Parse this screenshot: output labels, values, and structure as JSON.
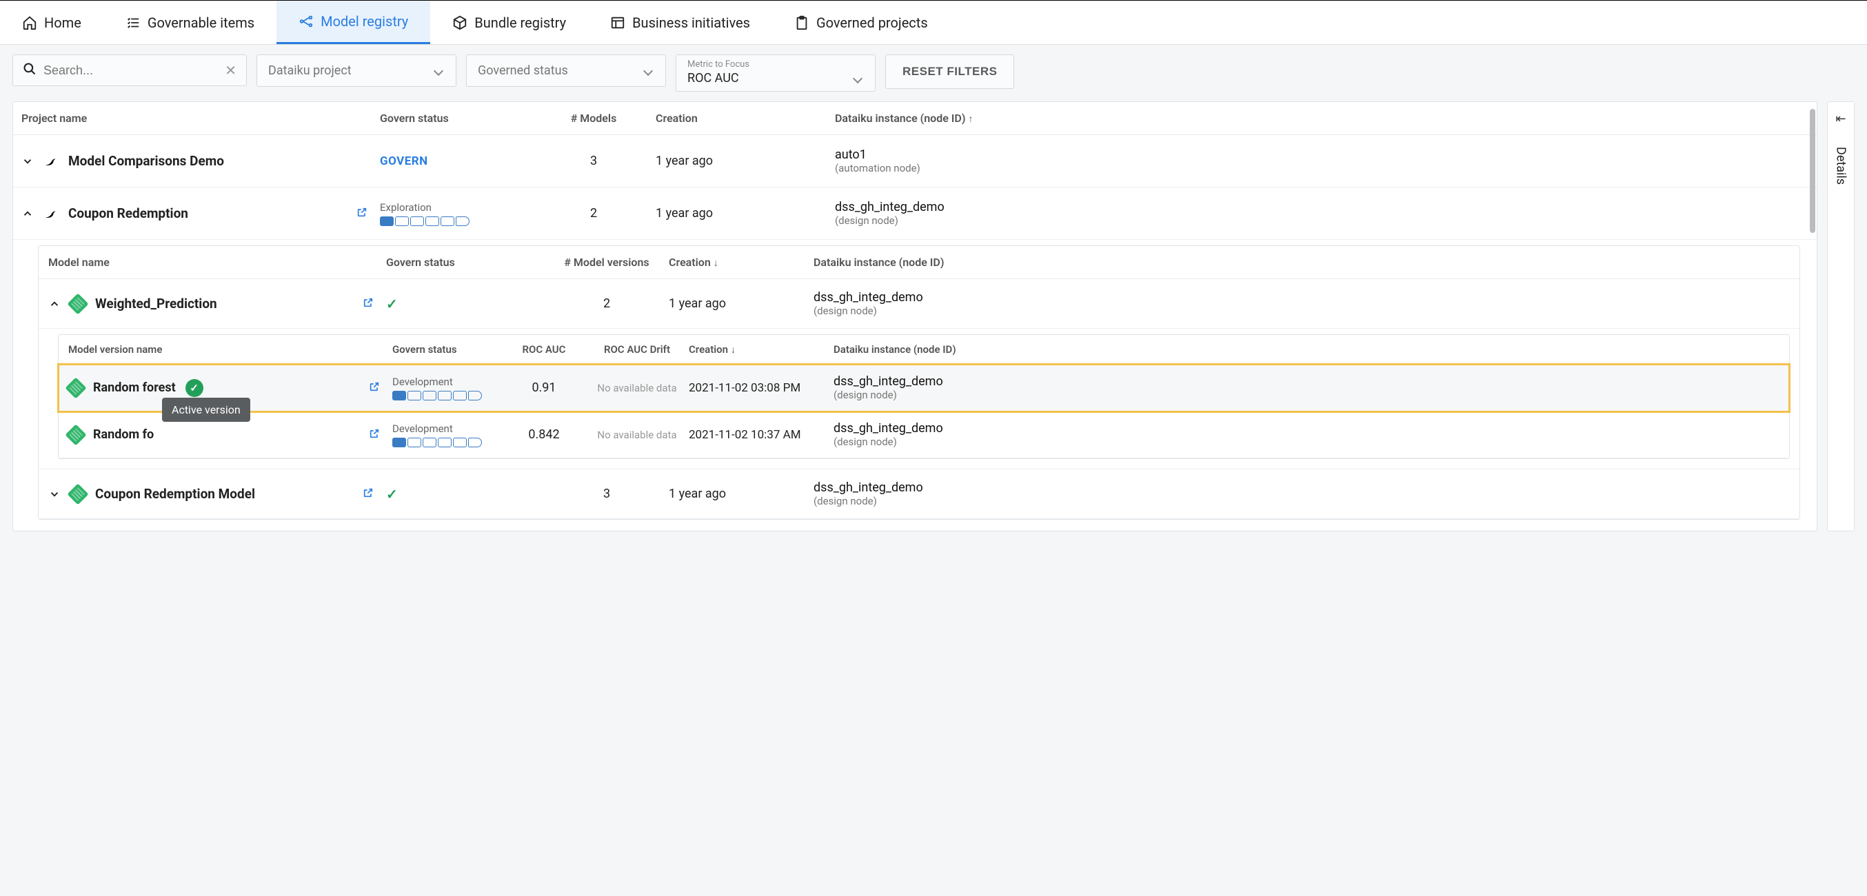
{
  "nav": {
    "home": "Home",
    "governable": "Governable items",
    "model_registry": "Model registry",
    "bundle_registry": "Bundle registry",
    "business": "Business initiatives",
    "governed": "Governed projects"
  },
  "filters": {
    "search_placeholder": "Search...",
    "project_dropdown": "Dataiku project",
    "status_dropdown": "Governed status",
    "metric_label": "Metric to Focus",
    "metric_value": "ROC AUC",
    "reset": "RESET FILTERS"
  },
  "headers": {
    "project": "Project name",
    "govern_status": "Govern status",
    "models": "# Models",
    "creation": "Creation",
    "instance": "Dataiku instance (node ID)"
  },
  "model_headers": {
    "name": "Model name",
    "govern_status": "Govern status",
    "versions": "# Model versions",
    "creation": "Creation",
    "instance": "Dataiku instance (node ID)"
  },
  "version_headers": {
    "name": "Model version name",
    "govern_status": "Govern status",
    "rocauc": "ROC AUC",
    "drift": "ROC AUC Drift",
    "creation": "Creation",
    "instance": "Dataiku instance (node ID)"
  },
  "projects": [
    {
      "name": "Model Comparisons Demo",
      "govern_status_type": "link",
      "govern_status": "GOVERN",
      "models": "3",
      "creation": "1 year ago",
      "instance_id": "auto1",
      "instance_type": "(automation node)"
    },
    {
      "name": "Coupon Redemption",
      "govern_status_type": "progress",
      "govern_status": "Exploration",
      "progress_fill": 1,
      "progress_total": 6,
      "models": "2",
      "creation": "1 year ago",
      "instance_id": "dss_gh_integ_demo",
      "instance_type": "(design node)"
    }
  ],
  "models": [
    {
      "name": "Weighted_Prediction",
      "govern_ok": true,
      "versions": "2",
      "creation": "1 year ago",
      "instance_id": "dss_gh_integ_demo",
      "instance_type": "(design node)"
    },
    {
      "name": "Coupon Redemption Model",
      "govern_ok": true,
      "versions": "3",
      "creation": "1 year ago",
      "instance_id": "dss_gh_integ_demo",
      "instance_type": "(design node)"
    }
  ],
  "versions": [
    {
      "name": "Random forest",
      "active": true,
      "status": "Development",
      "rocauc": "0.91",
      "drift": "No available data",
      "creation": "2021-11-02 03:08 PM",
      "instance_id": "dss_gh_integ_demo",
      "instance_type": "(design node)"
    },
    {
      "name": "Random fo",
      "active": false,
      "status": "Development",
      "rocauc": "0.842",
      "drift": "No available data",
      "creation": "2021-11-02 10:37 AM",
      "instance_id": "dss_gh_integ_demo",
      "instance_type": "(design node)"
    }
  ],
  "tooltip": "Active version",
  "details_label": "Details"
}
